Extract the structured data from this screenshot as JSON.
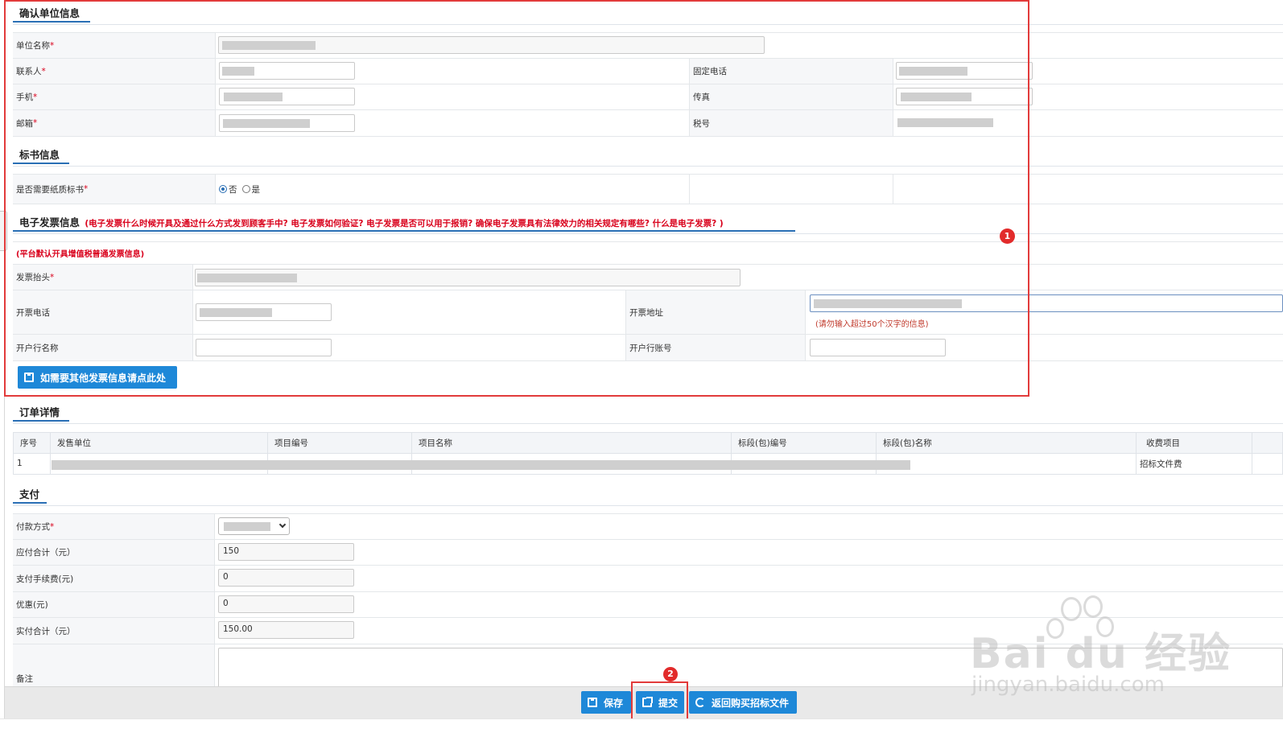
{
  "sections": {
    "unit_info": "确认单位信息",
    "bid_docs": "标书信息",
    "e_invoice": "电子发票信息",
    "order_detail": "订单详情",
    "payment": "支付"
  },
  "unit_info": {
    "company_name_label": "单位名称",
    "contact_label": "联系人",
    "phone_label": "固定电话",
    "mobile_label": "手机",
    "fax_label": "传真",
    "email_label": "邮箱",
    "tax_label": "税号",
    "required_mark": "*"
  },
  "bid_docs": {
    "paper_label": "是否需要纸质标书",
    "option_no": "否",
    "option_yes": "是",
    "selected": "否"
  },
  "e_invoice": {
    "faq_text": "(电子发票什么时候开具及通过什么方式发到顾客手中? 电子发票如何验证?  电子发票是否可以用于报销?  确保电子发票具有法律效力的相关规定有哪些? 什么是电子发票? )",
    "default_note": "(平台默认开具增值税普通发票信息)",
    "title_label": "发票抬头",
    "phone_label": "开票电话",
    "address_label": "开票地址",
    "address_hint": "(请勿输入超过50个汉字的信息)",
    "bank_label": "开户行名称",
    "account_label": "开户行账号",
    "other_invoice_button": "如需要其他发票信息请点此处"
  },
  "order_table": {
    "headers": [
      "序号",
      "发售单位",
      "项目编号",
      "项目名称",
      "标段(包)编号",
      "标段(包)名称",
      "收费项目"
    ],
    "rows": [
      {
        "index": "1",
        "fee_item": "招标文件费"
      }
    ]
  },
  "payment": {
    "method_label": "付款方式",
    "payable_label": "应付合计（元）",
    "payable_value": "150",
    "fee_label": "支付手续费(元)",
    "fee_value": "0",
    "discount_label": "优惠(元)",
    "discount_value": "0",
    "actual_label": "实付合计（元）",
    "actual_value": "150.00",
    "remark_label": "备注"
  },
  "footer": {
    "save_button": "保存",
    "submit_button": "提交",
    "return_button": "返回购买招标文件"
  },
  "annotations": {
    "marker_1": "1",
    "marker_2": "2"
  },
  "watermark": {
    "brand": "Bai du 经验",
    "url": "jingyan.baidu.com"
  },
  "colors": {
    "accent_blue": "#1e88d8",
    "section_underline": "#2a6fb5",
    "required_red": "#d9001b",
    "annotation_red": "#e23b3b"
  }
}
